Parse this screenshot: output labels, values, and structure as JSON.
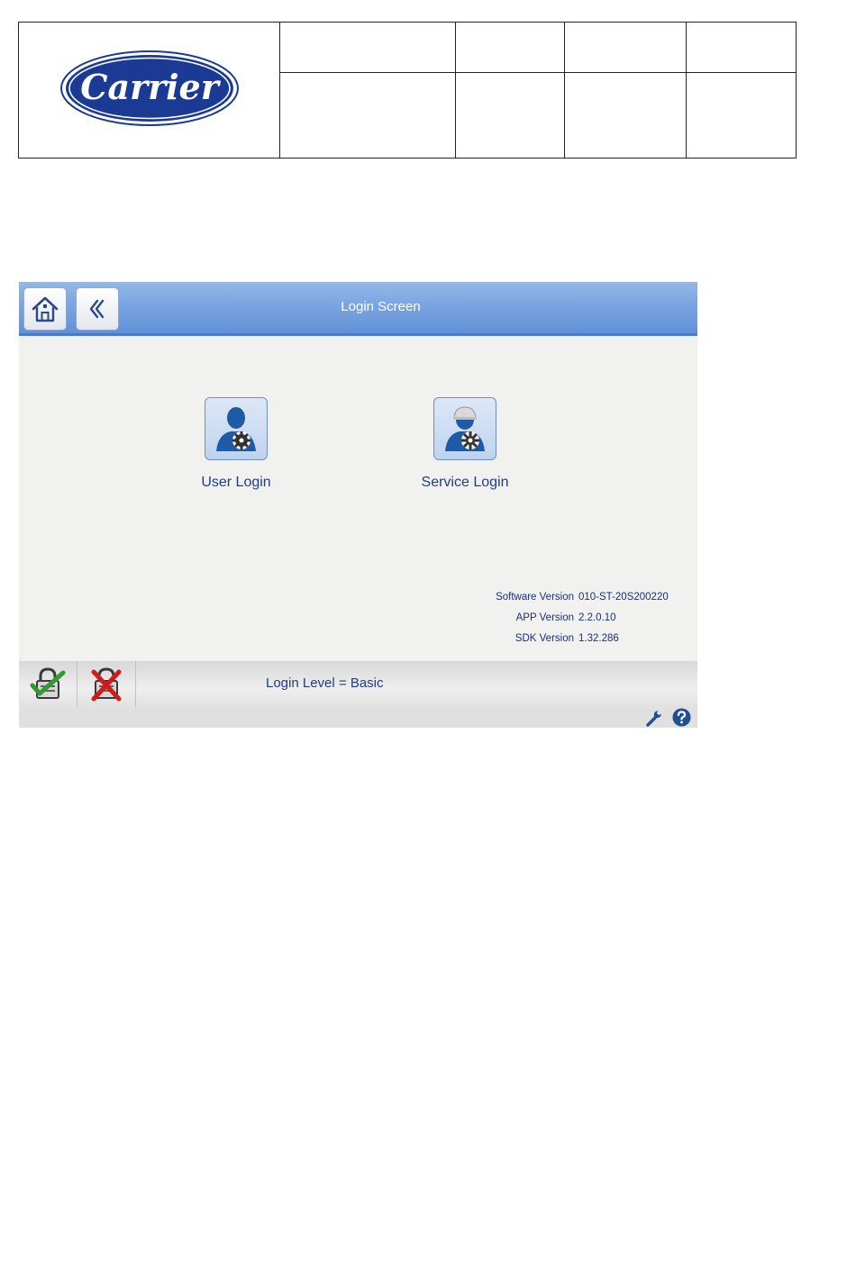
{
  "document_header": {
    "logo_text": "Carrier"
  },
  "app": {
    "title": "Login Screen",
    "nav": {
      "home_icon": "home-icon",
      "back_icon": "chevron-left-icon"
    },
    "login_options": [
      {
        "label": "User Login",
        "icon": "user-gear-icon"
      },
      {
        "label": "Service Login",
        "icon": "service-user-gear-icon"
      }
    ],
    "versions": [
      {
        "label": "Software Version",
        "value": "010-ST-20S200220"
      },
      {
        "label": "APP Version",
        "value": "2.2.0.10"
      },
      {
        "label": "SDK Version",
        "value": "1.32.286"
      }
    ],
    "bottom_bar": {
      "login_icon": "lock-check-icon",
      "logout_icon": "lock-cross-icon",
      "login_level": "Login Level = Basic"
    },
    "status_bar": {
      "wrench_icon": "wrench-icon",
      "help_icon": "help-icon"
    },
    "colors": {
      "title_bar": "#7aa4e1",
      "label_text": "#1f3d8c",
      "logo_blue": "#1b3a93"
    }
  }
}
